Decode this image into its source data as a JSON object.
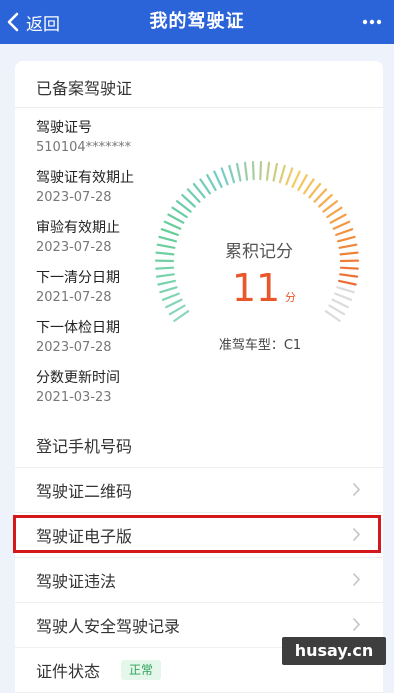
{
  "header": {
    "back_label": "返回",
    "title": "我的驾驶证",
    "background": "#2b63d9"
  },
  "card": {
    "title": "已备案驾驶证",
    "items": [
      {
        "label": "驾驶证号",
        "value": "510104*******"
      },
      {
        "label": "驾驶证有效期止",
        "value": "2023-07-28"
      },
      {
        "label": "审验有效期止",
        "value": "2023-07-28"
      },
      {
        "label": "下一清分日期",
        "value": "2021-07-28"
      },
      {
        "label": "下一体检日期",
        "value": "2023-07-28"
      },
      {
        "label": "分数更新时间",
        "value": "2021-03-23"
      }
    ]
  },
  "gauge": {
    "title": "累积记分",
    "score": "11",
    "unit": "分",
    "max": 12,
    "vehicle_type": "准驾车型：C1",
    "score_color": "#e8562a"
  },
  "menu": {
    "items": [
      {
        "label": "登记手机号码"
      },
      {
        "label": "驾驶证二维码"
      },
      {
        "label": "驾驶证电子版"
      },
      {
        "label": "驾驶证违法"
      },
      {
        "label": "驾驶人安全驾驶记录"
      }
    ],
    "status_label": "证件状态",
    "status_badge": "正常",
    "highlight_color": "#d3191b"
  },
  "watermark": "husay.cn"
}
